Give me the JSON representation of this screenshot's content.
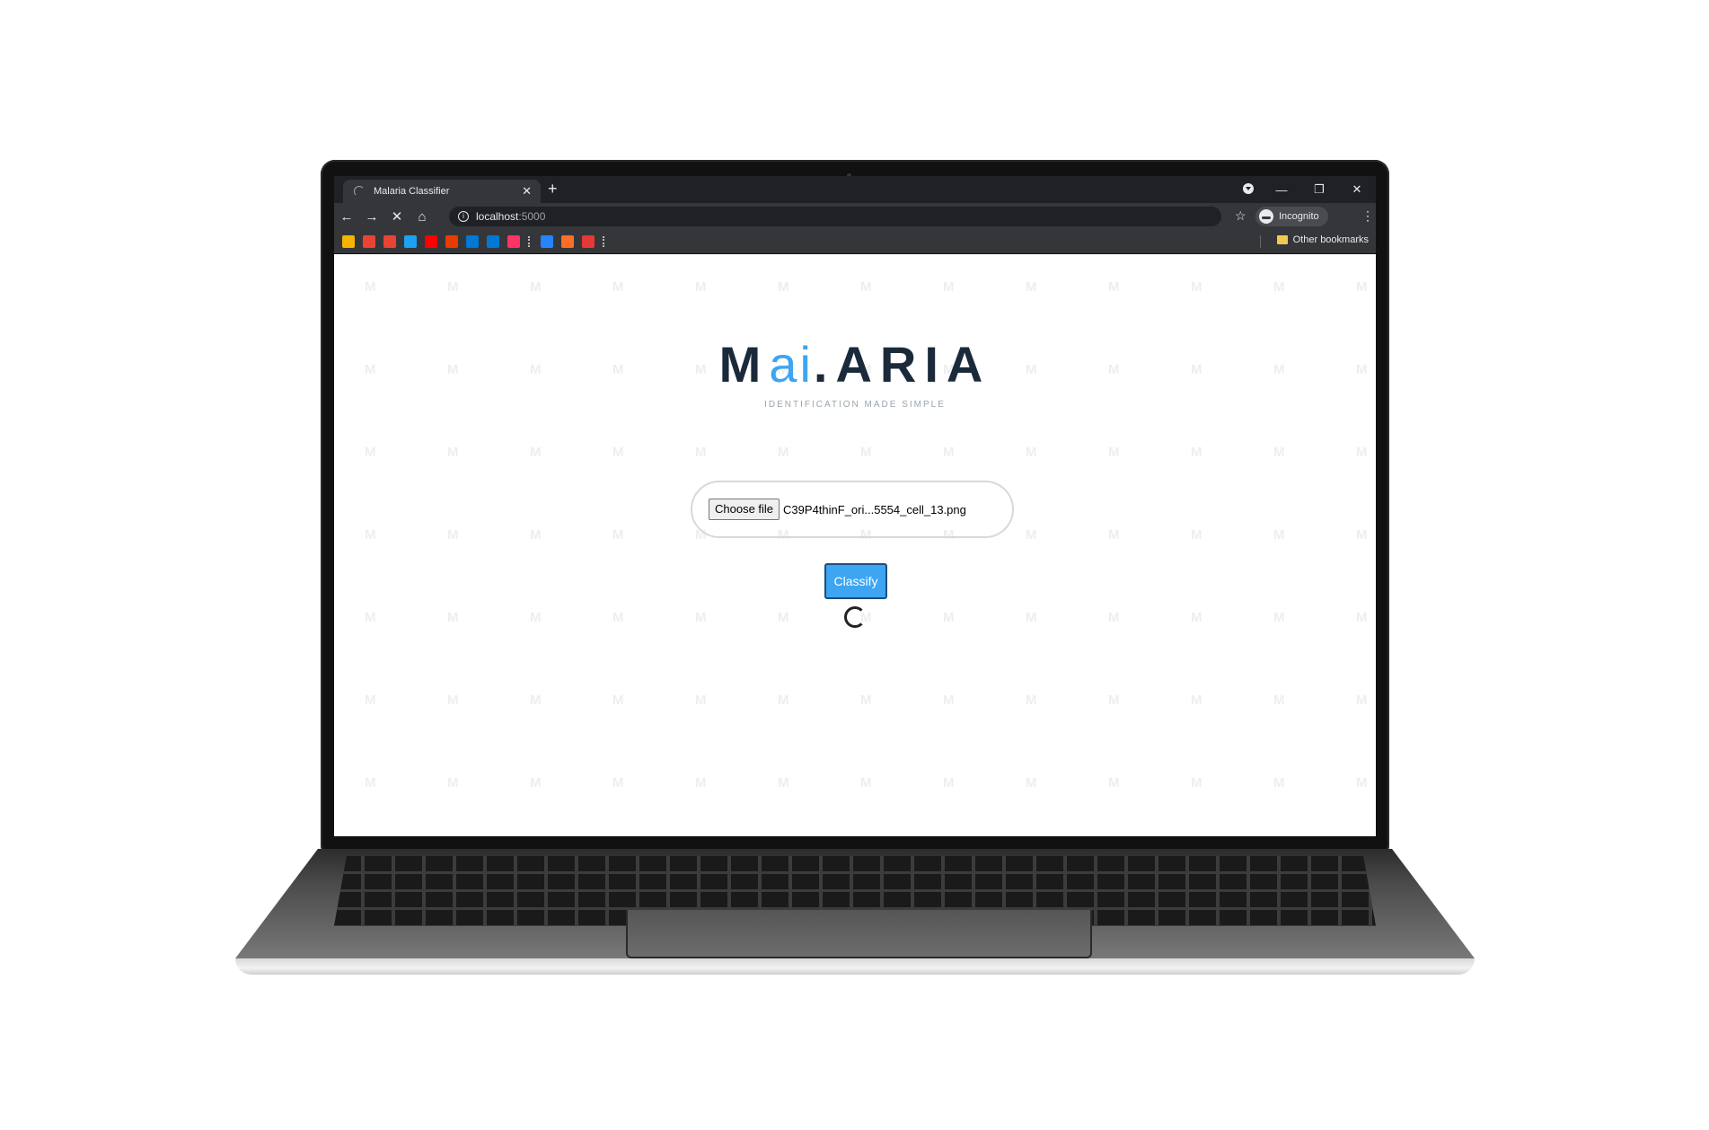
{
  "browser": {
    "tab_title": "Malaria Classifier",
    "tab_close": "✕",
    "new_tab": "+",
    "window_controls": [
      "—",
      "❐",
      "✕"
    ],
    "url_host": "localhost",
    "url_port": ":5000",
    "incognito_label": "Incognito",
    "other_bookmarks": "Other bookmarks",
    "bookmarks": [
      {
        "name": "google-drive",
        "color": "#f4b400"
      },
      {
        "name": "gmail",
        "color": "#ea4335"
      },
      {
        "name": "gmail-2",
        "color": "#ea4335"
      },
      {
        "name": "twitter",
        "color": "#1da1f2"
      },
      {
        "name": "youtube",
        "color": "#ff0000"
      },
      {
        "name": "office",
        "color": "#eb3c00"
      },
      {
        "name": "outlook",
        "color": "#0078d4"
      },
      {
        "name": "onedrive",
        "color": "#0078d4"
      },
      {
        "name": "invision",
        "color": "#ff3366"
      },
      {
        "name": "jira",
        "color": "#2684ff"
      },
      {
        "name": "gitlab",
        "color": "#fc6d26"
      },
      {
        "name": "bug-tracker",
        "color": "#e53935"
      }
    ]
  },
  "page": {
    "logo_left": "M",
    "logo_ai": "ai",
    "logo_right": "ARIA",
    "logo_dot": ".",
    "tagline": "IDENTIFICATION MADE SIMPLE",
    "choose_file_label": "Choose file",
    "selected_file": "C39P4thinF_ori...5554_cell_13.png",
    "classify_label": "Classify",
    "watermark_glyph": "M"
  },
  "colors": {
    "accent": "#3da5f2",
    "logo_dark": "#1a2a3a"
  }
}
